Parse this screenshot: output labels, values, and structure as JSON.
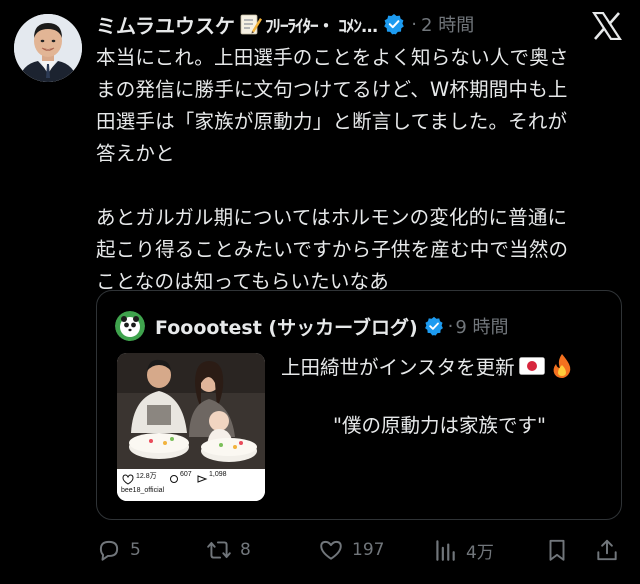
{
  "tweet": {
    "author_name": "ミムラユウスケ",
    "author_bio_name": "ﾌﾘｰﾗｲﾀｰ・ ｺﾒﾝ...",
    "dot": "·",
    "time": "2 時間",
    "body_lines": [
      "本当にこれ。上田選手のことをよく知らない人で奥さ",
      "まの発信に勝手に文句つけてるけど、W杯期間中も上",
      "田選手は「家族が原動力」と断言してました。それが",
      "答えかと"
    ],
    "body_lines_2": [
      "あとガルガル期についてはホルモンの変化的に普通に",
      "起こり得ることみたいですから子供を産む中で当然の",
      "ことなのは知ってもらいたいなあ"
    ]
  },
  "quote": {
    "author_name": "Fooootest (サッカーブログ)",
    "dot": "·",
    "time": "9 時間",
    "title": "上田綺世がインスタを更新",
    "quote_text": "\"僕の原動力は家族です\"",
    "image": {
      "likes": "12.8万",
      "comments": "607",
      "shares": "1,098",
      "account": "bee18_official"
    }
  },
  "actions": {
    "replies": "5",
    "reposts": "8",
    "likes": "197",
    "views": "4万"
  },
  "colors": {
    "background": "#000000",
    "text": "#e7e9ea",
    "muted": "#71767b",
    "verified": "#1d9bf0",
    "border": "#2f3336"
  }
}
